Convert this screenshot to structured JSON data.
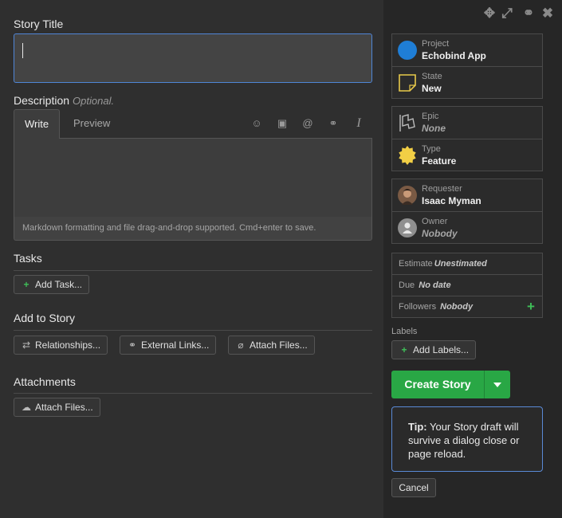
{
  "window_controls": {
    "move": "✥",
    "expand": "⤢",
    "link": "⚭",
    "close": "✖"
  },
  "story_title": {
    "label": "Story Title",
    "value": ""
  },
  "description": {
    "label": "Description",
    "optional": "Optional.",
    "tabs": {
      "write": "Write",
      "preview": "Preview"
    },
    "toolbar_icons": [
      "emoji-icon",
      "image-icon",
      "mention-icon",
      "link-icon",
      "italic-icon"
    ],
    "toolbar_glyphs": {
      "emoji": "☺",
      "image": "▣",
      "mention": "@",
      "link": "⚭",
      "italic": "I"
    },
    "footer": "Markdown formatting and file drag-and-drop supported. Cmd+enter to save."
  },
  "tasks": {
    "label": "Tasks",
    "add_button": "Add Task..."
  },
  "add_to_story": {
    "label": "Add to Story",
    "relationships": "Relationships...",
    "external_links": "External Links...",
    "attach_files": "Attach Files..."
  },
  "attachments": {
    "label": "Attachments",
    "attach_files": "Attach Files..."
  },
  "sidebar": {
    "project": {
      "label": "Project",
      "value": "Echobind App",
      "color": "#1f7ed6"
    },
    "state": {
      "label": "State",
      "value": "New",
      "color": "#e8c94a"
    },
    "epic": {
      "label": "Epic",
      "value": "None"
    },
    "type": {
      "label": "Type",
      "value": "Feature",
      "color": "#f2cf45"
    },
    "requester": {
      "label": "Requester",
      "value": "Isaac Myman"
    },
    "owner": {
      "label": "Owner",
      "value": "Nobody"
    },
    "estimate": {
      "label": "Estimate",
      "value": "Unestimated"
    },
    "due": {
      "label": "Due",
      "value": "No date"
    },
    "followers": {
      "label": "Followers",
      "value": "Nobody",
      "add": "+"
    },
    "labels": {
      "label": "Labels",
      "add_button": "Add Labels..."
    }
  },
  "actions": {
    "create": "Create Story",
    "tip_bold": "Tip:",
    "tip_text": "Your Story draft will survive a dialog close or page reload.",
    "cancel": "Cancel"
  },
  "colors": {
    "accent_green": "#29a745",
    "focus_blue": "#4f86d6"
  }
}
